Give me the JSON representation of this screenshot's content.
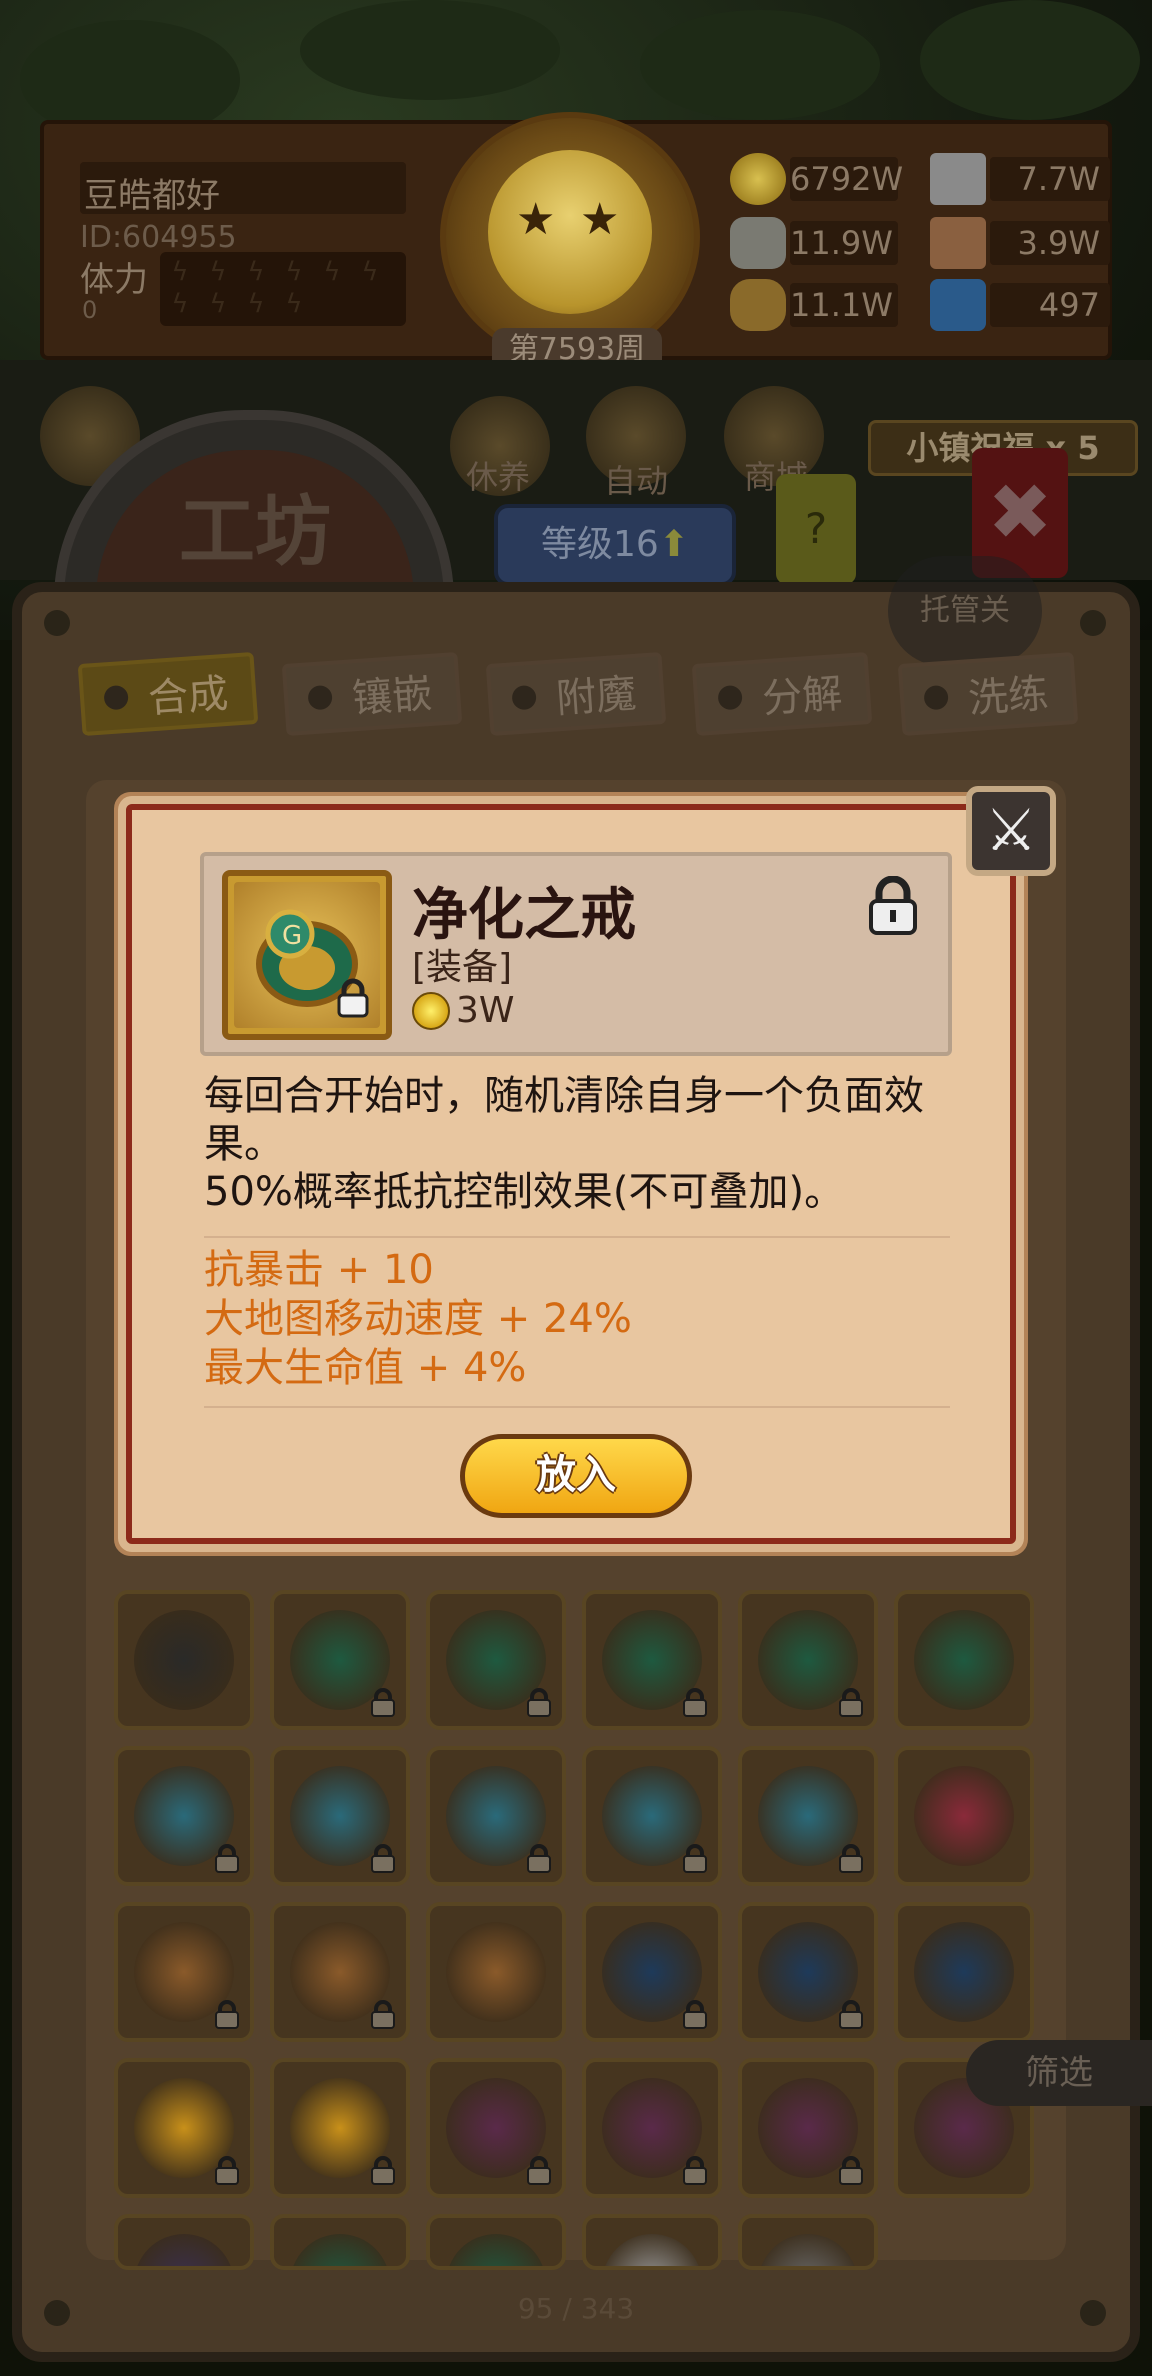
{
  "player": {
    "name": "豆皓都好",
    "id": "ID:604955",
    "stamina_label": "体力",
    "stamina_value": "0"
  },
  "week": "第7593周",
  "resources": [
    {
      "icon": "gold-coin-icon",
      "value": "6792W"
    },
    {
      "icon": "iron-ingot-icon",
      "value": "7.7W"
    },
    {
      "icon": "stone-icon",
      "value": "11.9W"
    },
    {
      "icon": "leather-icon",
      "value": "3.9W"
    },
    {
      "icon": "wood-log-icon",
      "value": "11.1W"
    },
    {
      "icon": "crystal-icon",
      "value": "497"
    }
  ],
  "nav": {
    "rest": "休养",
    "auto": "自动",
    "shop": "商城"
  },
  "blessing": "小镇祝福 x 5",
  "workshop_title": "工坊",
  "level": "等级16",
  "help": "?",
  "autoplay_off": "托管关",
  "tabs": [
    {
      "label": "合成",
      "active": true
    },
    {
      "label": "镶嵌",
      "active": false
    },
    {
      "label": "附魔",
      "active": false
    },
    {
      "label": "分解",
      "active": false
    },
    {
      "label": "洗练",
      "active": false
    }
  ],
  "popup": {
    "name": "净化之戒",
    "type": "[装备]",
    "price": "3W",
    "description": [
      "每回合开始时，随机清除自身一个负面效",
      "果。",
      "50%概率抵抗控制效果(不可叠加)。"
    ],
    "stats": [
      "抗暴击 + 10",
      "大地图移动速度 + 24%",
      "最大生命值 + 4%"
    ],
    "place_button": "放入"
  },
  "filter": "筛选",
  "pager": "95 / 343",
  "colors": {
    "stat_orange": "#d46a12",
    "popup_bg": "#e8c6a0",
    "button_gold": "#f0a612"
  }
}
